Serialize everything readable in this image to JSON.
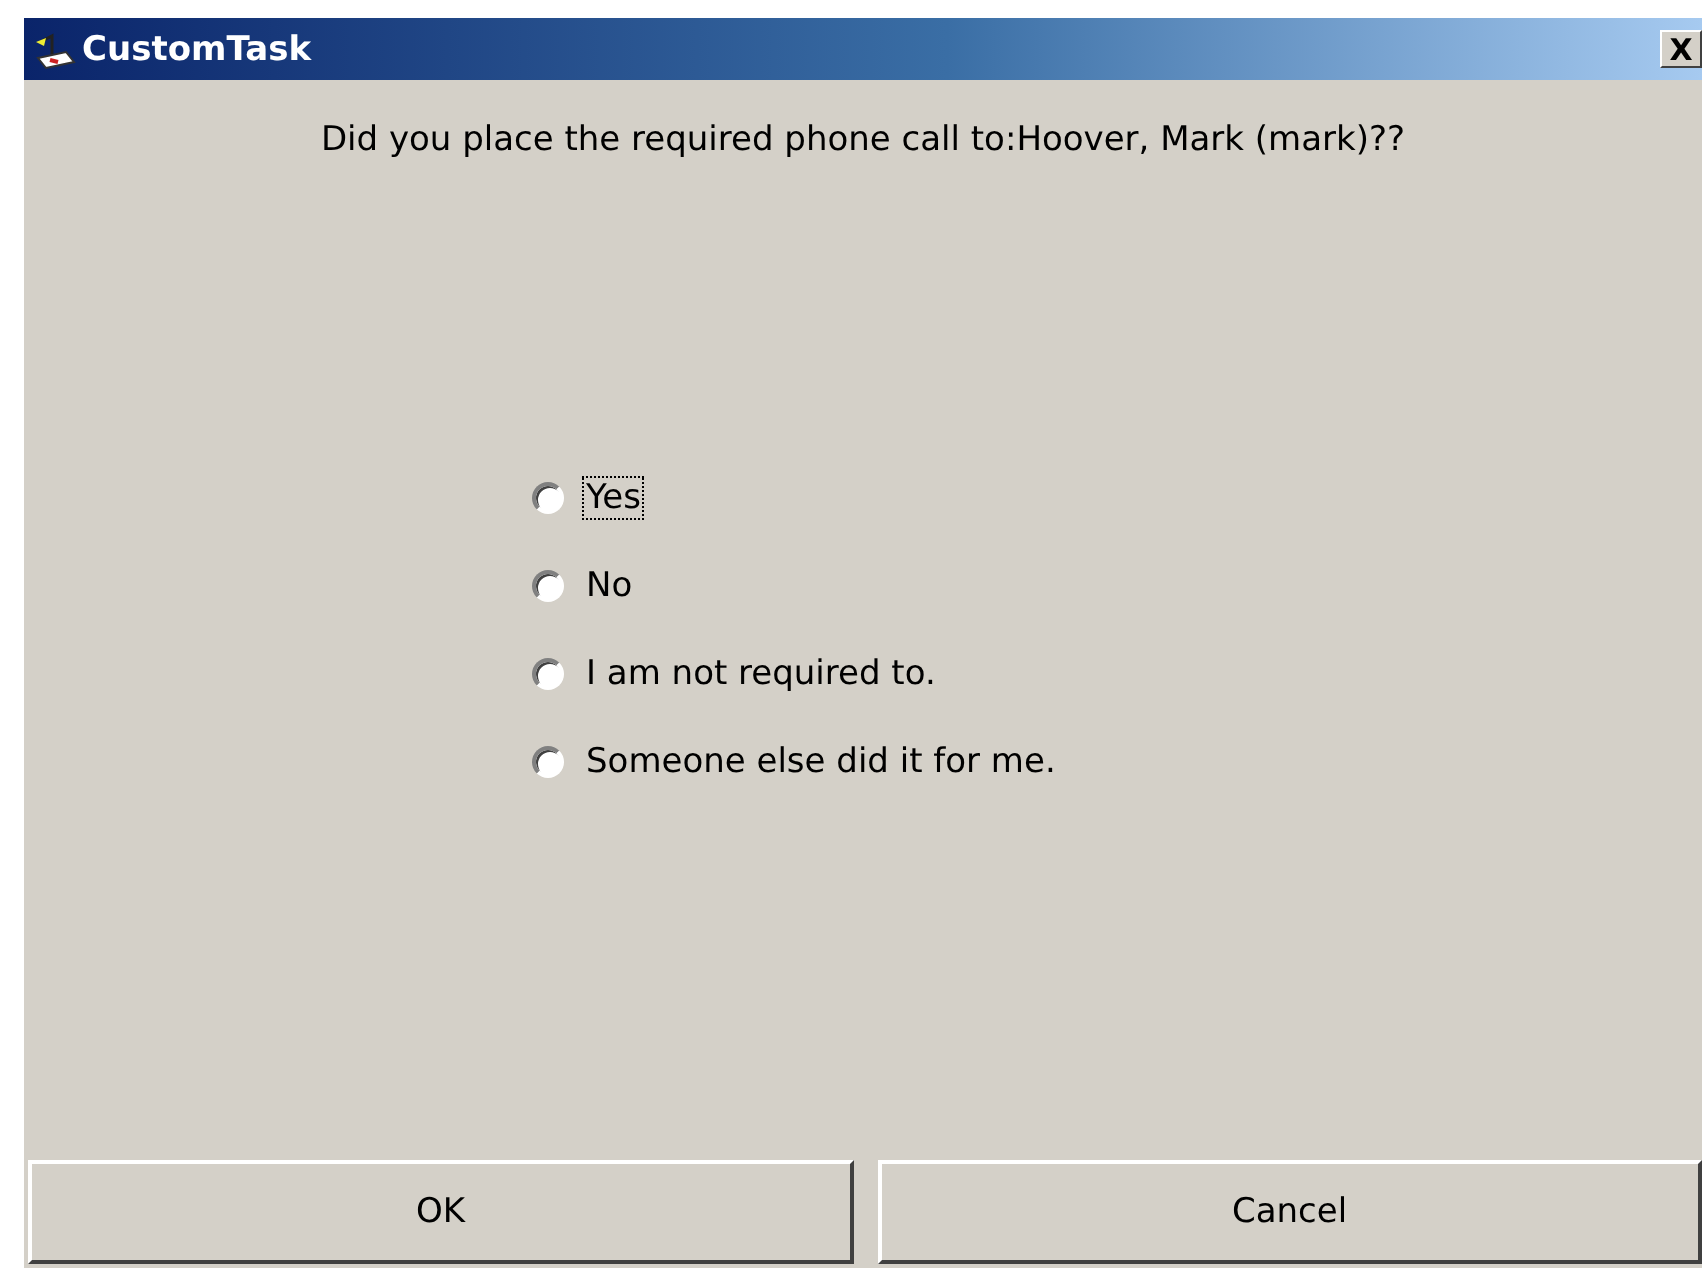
{
  "window": {
    "title": "CustomTask",
    "close": "X"
  },
  "question": "Did you place the required phone call to:Hoover, Mark (mark)??",
  "options": [
    {
      "label": "Yes",
      "selected": false,
      "focused": true
    },
    {
      "label": "No",
      "selected": false,
      "focused": false
    },
    {
      "label": "I am not required to.",
      "selected": false,
      "focused": false
    },
    {
      "label": "Someone else did it for me.",
      "selected": false,
      "focused": false
    }
  ],
  "buttons": [
    "OK",
    "Cancel"
  ]
}
